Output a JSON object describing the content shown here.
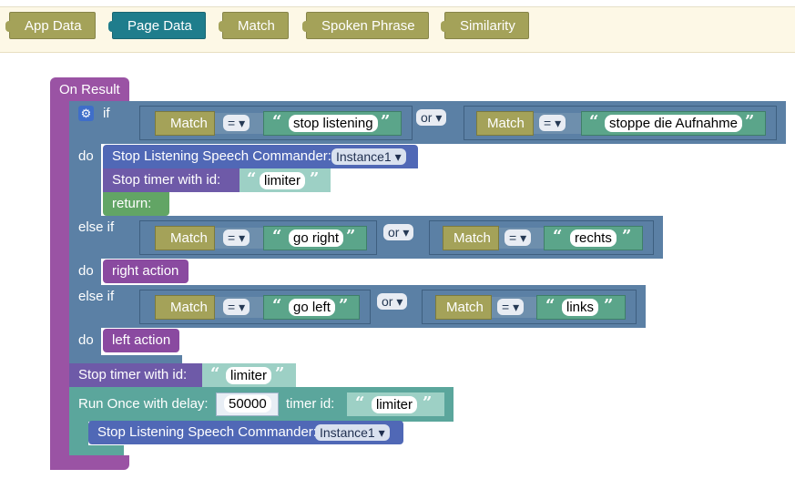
{
  "tabs": [
    "App Data",
    "Page Data",
    "Match",
    "Spoken Phrase",
    "Similarity"
  ],
  "event": {
    "label": "On Result"
  },
  "gear_icon": "gear-icon",
  "if_block": {
    "if_label": "if",
    "do_label": "do",
    "elseif_label": "else if",
    "or_label": "or",
    "eq_label": "=",
    "match_label": "Match",
    "cond1": {
      "left": "stop listening",
      "right": "stoppe die Aufnahme"
    },
    "cond2": {
      "left": "go right",
      "right": "rechts"
    },
    "cond3": {
      "left": "go left",
      "right": "links"
    }
  },
  "stop_listening": {
    "label": "Stop Listening Speech Commander:",
    "instance": "Instance1"
  },
  "stop_timer": {
    "label": "Stop timer with id:",
    "id": "limiter"
  },
  "return_label": "return:",
  "right_action": "right action",
  "left_action": "left action",
  "run_once": {
    "label": "Run Once with delay:",
    "delay": "50000",
    "timer_label": "timer id:",
    "timer_id": "limiter"
  }
}
